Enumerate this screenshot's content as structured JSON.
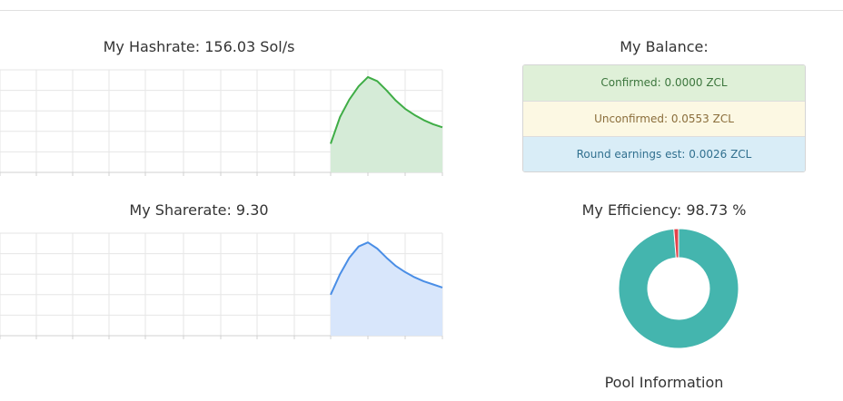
{
  "hashrate": {
    "title": "My Hashrate: 156.03 Sol/s",
    "color": "#3fad46",
    "fill": "#d5ebd7"
  },
  "sharerate": {
    "title": "My Sharerate: 9.30",
    "color": "#4a8ee6",
    "fill": "#d8e6fb"
  },
  "balance": {
    "title": "My Balance:",
    "confirmed": "Confirmed: 0.0000 ZCL",
    "unconfirmed": "Unconfirmed: 0.0553 ZCL",
    "round_earnings": "Round earnings est: 0.0026 ZCL"
  },
  "efficiency": {
    "title": "My Efficiency: 98.73 %"
  },
  "pool": {
    "title": "Pool Information"
  },
  "chart_data": [
    {
      "type": "area",
      "series": [
        {
          "values": [
            0.28,
            0.54,
            0.71,
            0.84,
            0.93,
            0.89,
            0.8,
            0.7,
            0.62,
            0.56,
            0.51,
            0.47,
            0.44
          ]
        }
      ],
      "ylim": [
        0,
        1
      ],
      "grid": true
    },
    {
      "type": "area",
      "series": [
        {
          "values": [
            0.4,
            0.6,
            0.76,
            0.87,
            0.91,
            0.85,
            0.76,
            0.68,
            0.62,
            0.57,
            0.53,
            0.5,
            0.47
          ]
        }
      ],
      "ylim": [
        0,
        1
      ],
      "grid": true
    },
    {
      "type": "pie",
      "donut": true,
      "slices": [
        {
          "value": 98.73,
          "color": "#44b5ae"
        },
        {
          "value": 1.27,
          "color": "#e2434b"
        }
      ]
    }
  ]
}
